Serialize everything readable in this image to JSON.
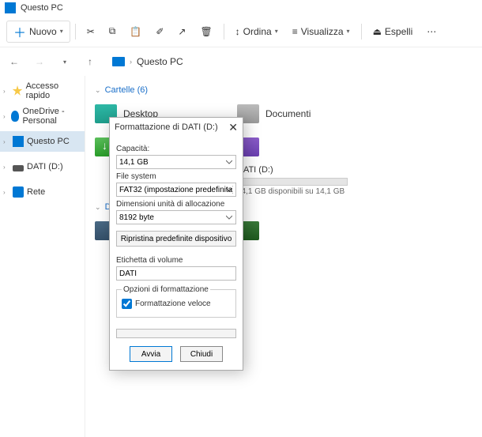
{
  "window": {
    "title": "Questo PC"
  },
  "toolbar": {
    "new": "Nuovo",
    "sort": "Ordina",
    "view": "Visualizza",
    "eject": "Espelli"
  },
  "address": {
    "path": "Questo PC"
  },
  "sidebar": {
    "items": [
      {
        "label": "Accesso rapido"
      },
      {
        "label": "OneDrive - Personal"
      },
      {
        "label": "Questo PC"
      },
      {
        "label": "DATI (D:)"
      },
      {
        "label": "Rete"
      }
    ]
  },
  "groups": {
    "folders": "Cartelle (6)",
    "devices": "Disp"
  },
  "folders": [
    {
      "label": "Desktop"
    },
    {
      "label": "Documenti"
    },
    {
      "label": "Download"
    }
  ],
  "drive": {
    "name": "DATI (D:)",
    "status": "14,1 GB disponibili su 14,1 GB"
  },
  "dialog": {
    "title": "Formattazione di DATI (D:)",
    "capacity_label": "Capacità:",
    "capacity_value": "14,1 GB",
    "fs_label": "File system",
    "fs_value": "FAT32 (impostazione predefinita)",
    "alloc_label": "Dimensioni unità di allocazione",
    "alloc_value": "8192 byte",
    "restore": "Ripristina predefinite dispositivo",
    "vol_label": "Etichetta di volume",
    "vol_value": "DATI",
    "opts_label": "Opzioni di formattazione",
    "quick": "Formattazione veloce",
    "start": "Avvia",
    "close": "Chiudi"
  }
}
